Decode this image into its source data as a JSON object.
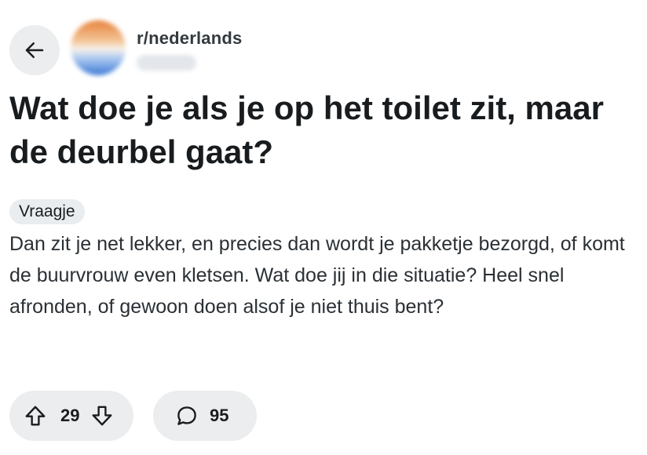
{
  "header": {
    "subreddit": "r/nederlands",
    "back_icon": "arrow-left-icon"
  },
  "post": {
    "title": "Wat doe je als je op het toilet zit, maar de deurbel gaat?",
    "flair": "Vraagje",
    "body": "Dan zit je net lekker, en precies dan wordt je pakketje bezorgd, of komt de buurvrouw even kletsen. Wat doe jij in die situatie? Heel snel afronden, of gewoon doen alsof je niet thuis bent?"
  },
  "actions": {
    "vote_count": "29",
    "comment_count": "95",
    "upvote_icon": "arrow-up-icon",
    "downvote_icon": "arrow-down-icon",
    "comment_icon": "speech-bubble-icon"
  }
}
